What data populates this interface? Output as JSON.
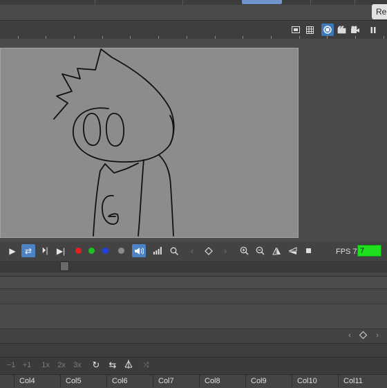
{
  "top": {
    "right_button": "Re"
  },
  "viewer_toolbar": {
    "icons": [
      "camera-view-icon",
      "grid-icon",
      "preview-toggle-icon",
      "clapper-icon",
      "clapper-add-icon",
      "pause-icon"
    ]
  },
  "playback": {
    "play_label": "▶",
    "loop_label": "⇄",
    "next_frame_label": "⏵|",
    "last_frame_label": "▶|",
    "fps_label": "FPS 7/",
    "fps_value": "7",
    "fps_field_color": "#1ee01e",
    "channel_colors": [
      "#e02020",
      "#20c020",
      "#2040e0",
      "#8a8a8a"
    ]
  },
  "timeline_toolbar": {
    "items": [
      "−1",
      "+1",
      "1x",
      "2x",
      "3x"
    ]
  },
  "columns": [
    "Col4",
    "Col5",
    "Col6",
    "Col7",
    "Col8",
    "Col9",
    "Col10",
    "Col11"
  ],
  "accent_color": "#4d82c4"
}
